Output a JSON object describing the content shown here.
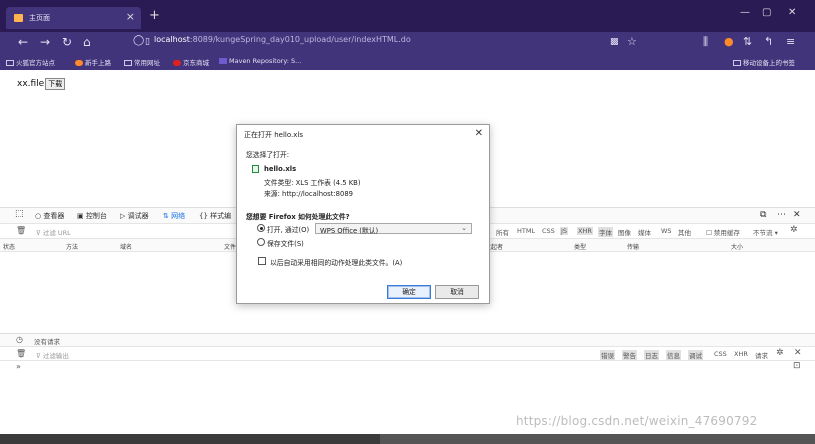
{
  "browser": {
    "tab_title": "主页面",
    "url_host": "localhost",
    "url_rest": ":8089/kungeSpring_day010_upload/user/indexHTML.do",
    "bookmarks": [
      "火狐官方站点",
      "新手上路",
      "常用网址",
      "京东商城",
      "Maven Repository: S...",
      "移动设备上的书签"
    ]
  },
  "page": {
    "file_text": "xx.file",
    "download_label": "下载"
  },
  "devtools": {
    "tabs": [
      "查看器",
      "控制台",
      "调试器",
      "网络",
      "样式编"
    ],
    "filter_placeholder": "过滤 URL",
    "type_filters": [
      "所有",
      "HTML",
      "CSS",
      "JS",
      "XHR",
      "字体",
      "图像",
      "媒体",
      "WS",
      "其他"
    ],
    "disable_cache": "禁用缓存",
    "throttle": "不节流 ▾",
    "columns": [
      "状态",
      "方法",
      "域名",
      "文件",
      "发起者",
      "类型",
      "传输",
      "大小"
    ],
    "status_text": "没有请求",
    "console_filter": "过滤输出",
    "console_levels": [
      "错误",
      "警告",
      "日志",
      "信息",
      "调试"
    ],
    "console_extra": [
      "CSS",
      "XHR",
      "请求"
    ],
    "prompt": "»"
  },
  "dialog": {
    "title": "正在打开 hello.xls",
    "chosen": "您选择了打开:",
    "filename": "hello.xls",
    "file_type": "文件类型:  XLS 工作表 (4.5 KB)",
    "source": "来源:   http://localhost:8089",
    "question": "您想要 Firefox 如何处理此文件?",
    "open_with": "打开, 通过(O)",
    "app": "WPS Office (默认)",
    "save_file": "保存文件(S)",
    "auto_action": "以后自动采用相同的动作处理此类文件。(A)",
    "ok": "确定",
    "cancel": "取消"
  },
  "watermark": "https://blog.csdn.net/weixin_47690792",
  "colors": {
    "chrome": "#2b1b55",
    "toolbar": "#42347a",
    "accent": "#1a6fe0"
  }
}
